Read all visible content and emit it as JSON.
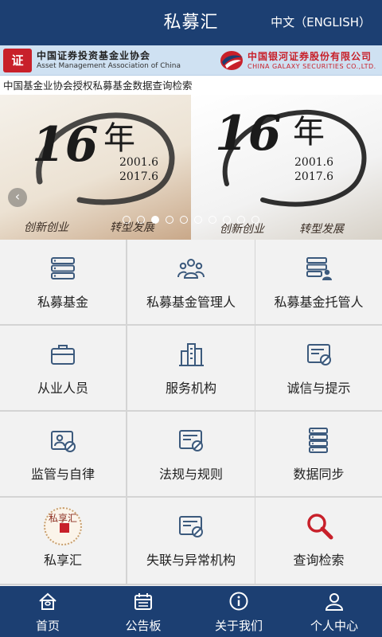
{
  "header": {
    "title": "私募汇",
    "language_toggle": "中文（ENGLISH）"
  },
  "banner": {
    "left_logo_glyph": "证",
    "left_org_cn": "中国证券投资基金业协会",
    "left_org_en": "Asset Management Association of China",
    "right_org_cn": "中国银河证券股份有限公司",
    "right_org_en": "CHINA GALAXY SECURITIES CO.,LTD.",
    "subtitle": "中国基金业协会授权私募基金数据查询检索"
  },
  "carousel": {
    "slides": [
      {
        "number": "16",
        "char": "年",
        "date_start": "2001.6",
        "date_end": "2017.6",
        "slogan_left": "创新创业",
        "slogan_right": "转型发展"
      },
      {
        "number": "16",
        "char": "年",
        "date_start": "2001.6",
        "date_end": "2017.6",
        "slogan_left": "创新创业",
        "slogan_right": "转型发展"
      }
    ],
    "dot_count": 10,
    "active_dot": 2,
    "prev_arrow": "‹"
  },
  "menu": [
    {
      "label": "私募基金",
      "icon": "fund-stack-icon"
    },
    {
      "label": "私募基金管理人",
      "icon": "managers-group-icon"
    },
    {
      "label": "私募基金托管人",
      "icon": "custodian-server-icon"
    },
    {
      "label": "从业人员",
      "icon": "briefcase-icon"
    },
    {
      "label": "服务机构",
      "icon": "building-icon"
    },
    {
      "label": "诚信与提示",
      "icon": "warning-card-icon"
    },
    {
      "label": "监管与自律",
      "icon": "supervision-icon"
    },
    {
      "label": "法规与规则",
      "icon": "regulation-icon"
    },
    {
      "label": "数据同步",
      "icon": "data-sync-icon"
    },
    {
      "label": "私享汇",
      "icon": "private-seal-icon"
    },
    {
      "label": "失联与异常机构",
      "icon": "abnormal-org-icon"
    },
    {
      "label": "查询检索",
      "icon": "search-icon"
    }
  ],
  "seal_text": "私享汇",
  "tabbar": [
    {
      "label": "首页",
      "icon": "home-icon"
    },
    {
      "label": "公告板",
      "icon": "bulletin-icon"
    },
    {
      "label": "关于我们",
      "icon": "info-icon"
    },
    {
      "label": "个人中心",
      "icon": "user-icon"
    }
  ],
  "colors": {
    "primary": "#1c3f72",
    "icon_blue": "#3c5a7d",
    "search_red": "#c8202a",
    "grid_bg": "#f2f2f2"
  }
}
